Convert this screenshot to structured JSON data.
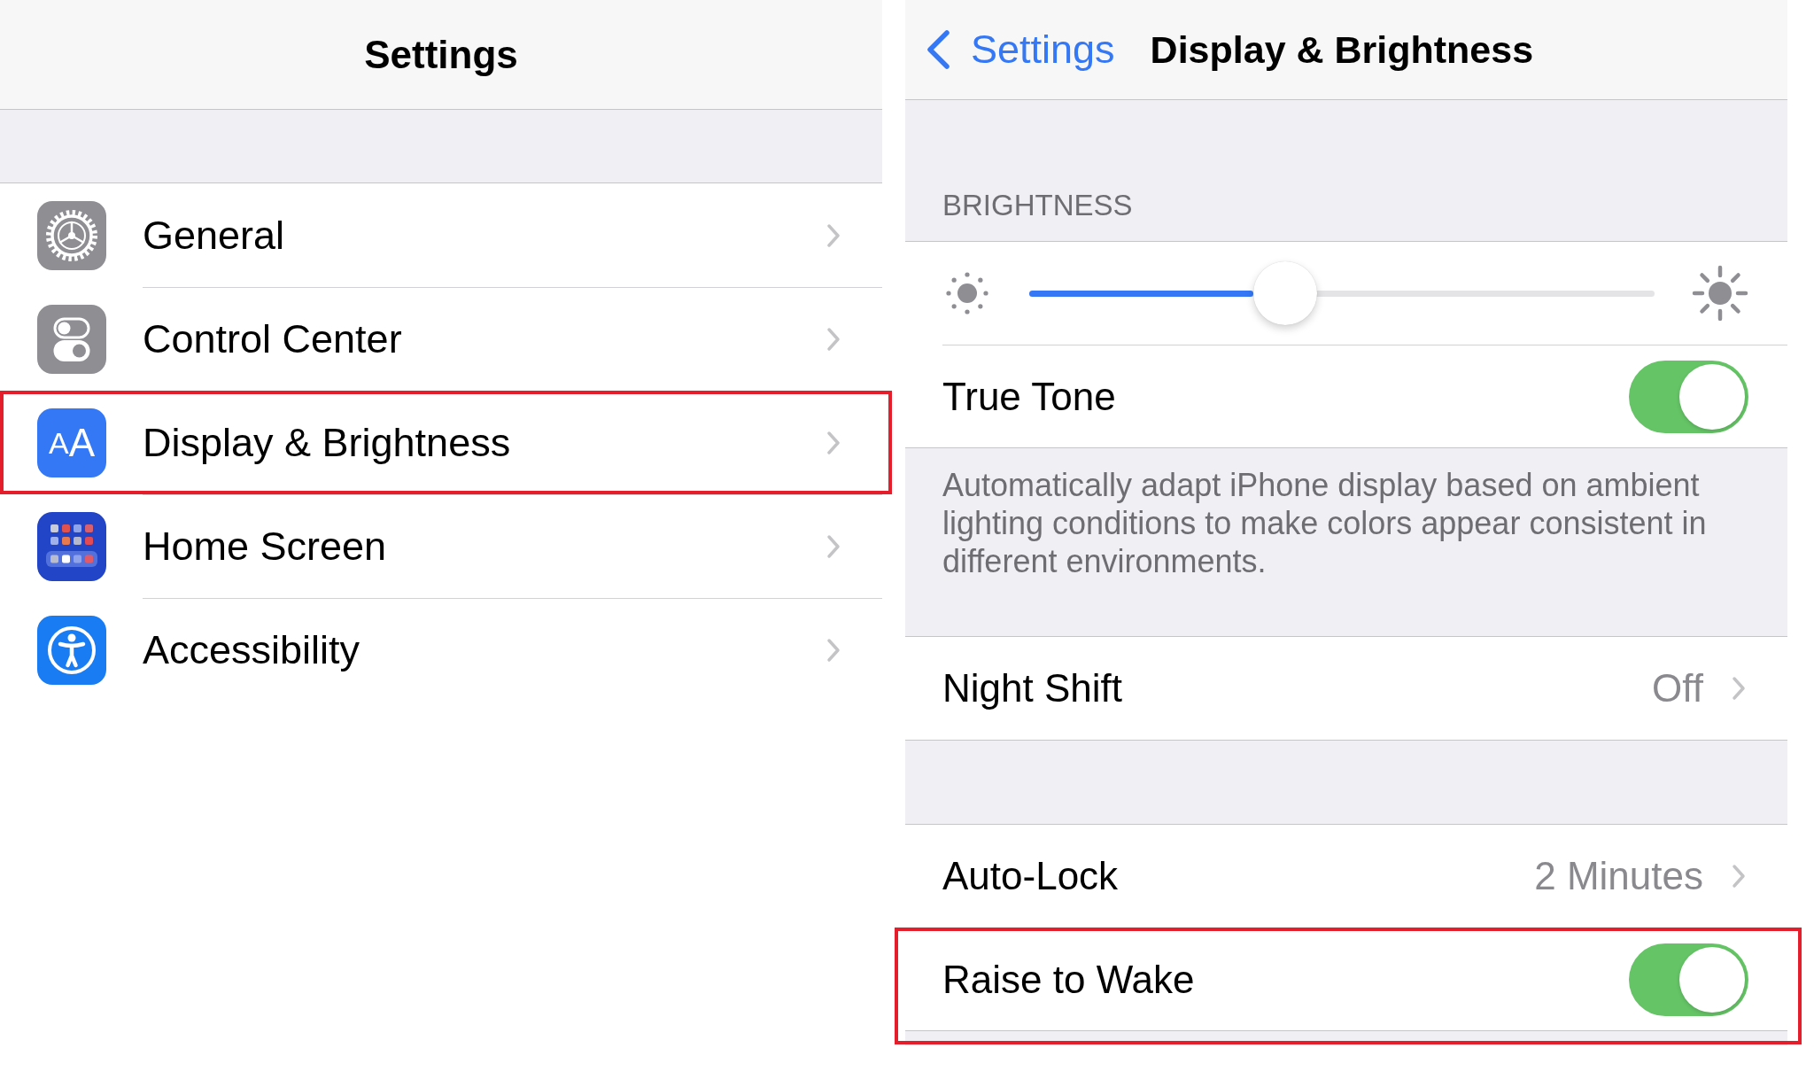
{
  "settings_panel": {
    "nav_bar": {
      "title": "Settings"
    },
    "rows": [
      {
        "label": "General",
        "highlighted": false
      },
      {
        "label": "Control Center",
        "highlighted": false
      },
      {
        "label": "Display & Brightness",
        "icon_text": "AA",
        "highlighted": true
      },
      {
        "label": "Home Screen",
        "highlighted": false
      },
      {
        "label": "Accessibility",
        "highlighted": false
      }
    ]
  },
  "display_panel": {
    "nav_bar": {
      "back_label": "Settings",
      "title": "Display & Brightness"
    },
    "sections": [
      {
        "header": "BRIGHTNESS",
        "rows": [
          {
            "kind": "slider",
            "level": 0.41,
            "highlighted": false
          },
          {
            "kind": "toggle",
            "label": "True Tone",
            "on": true,
            "highlighted": false
          }
        ],
        "footer": "Automatically adapt iPhone display based on ambient lighting conditions to make colors appear consistent in different environments."
      },
      {
        "rows": [
          {
            "kind": "disclosure",
            "label": "Night Shift",
            "value": "Off",
            "highlighted": false
          }
        ]
      },
      {
        "rows": [
          {
            "kind": "disclosure",
            "label": "Auto-Lock",
            "value": "2 Minutes",
            "highlighted": false
          },
          {
            "kind": "toggle",
            "label": "Raise to Wake",
            "on": true,
            "highlighted": true
          }
        ]
      }
    ]
  }
}
